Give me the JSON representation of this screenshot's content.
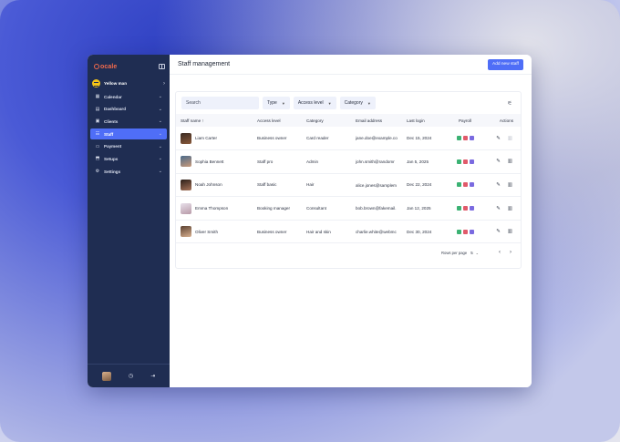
{
  "app": {
    "brand": "ocale",
    "business_name": "Yellow man"
  },
  "sidebar": {
    "items": [
      {
        "label": "Calendar",
        "icon": "calendar-icon",
        "active": false
      },
      {
        "label": "Dashboard",
        "icon": "dashboard-icon",
        "active": false
      },
      {
        "label": "Clients",
        "icon": "clients-icon",
        "active": false
      },
      {
        "label": "Staff",
        "icon": "staff-icon",
        "active": true
      },
      {
        "label": "Payment",
        "icon": "payment-icon",
        "active": false
      },
      {
        "label": "Setups",
        "icon": "setups-icon",
        "active": false
      },
      {
        "label": "Settings",
        "icon": "settings-icon",
        "active": false
      }
    ]
  },
  "header": {
    "title": "Staff management",
    "add_button": "Add new staff"
  },
  "filters": {
    "search_placeholder": "Search",
    "type": "Type",
    "access_level": "Access level",
    "category": "Category"
  },
  "table": {
    "columns": {
      "staff_name": "Staff name ↑",
      "access_level": "Access level",
      "category": "Category",
      "email": "Email address",
      "last_login": "Last login",
      "payroll": "Payroll",
      "actions": "Actions"
    },
    "rows": [
      {
        "name": "Liam Carter",
        "access": "Business owner",
        "category": "Card reader",
        "email": "jane.doe@example.co",
        "last_login": "Dec 15, 2024"
      },
      {
        "name": "Sophia Bennett",
        "access": "Staff pro",
        "category": "Admin",
        "email": "john.smith@randomr",
        "last_login": "Jan 5, 2025"
      },
      {
        "name": "Noah Johnson",
        "access": "Staff basic",
        "category": "Hair",
        "email": "alice.jones@samplem",
        "last_login": "Dec 22, 2024"
      },
      {
        "name": "Emma Thompson",
        "access": "Booking manager",
        "category": "Consultant",
        "email": "bob.brown@fakemail.",
        "last_login": "Jan 12, 2025"
      },
      {
        "name": "Oliver Smith",
        "access": "Business owner",
        "category": "Hair and skin",
        "email": "charlie.white@webmc",
        "last_login": "Dec 30, 2024"
      }
    ]
  },
  "pagination": {
    "rows_per_page_label": "Rows per page",
    "rows_per_page_value": "5"
  },
  "colors": {
    "sidebar_bg": "#1f2d52",
    "accent": "#4f6ef7",
    "brand": "#f36a4c"
  }
}
